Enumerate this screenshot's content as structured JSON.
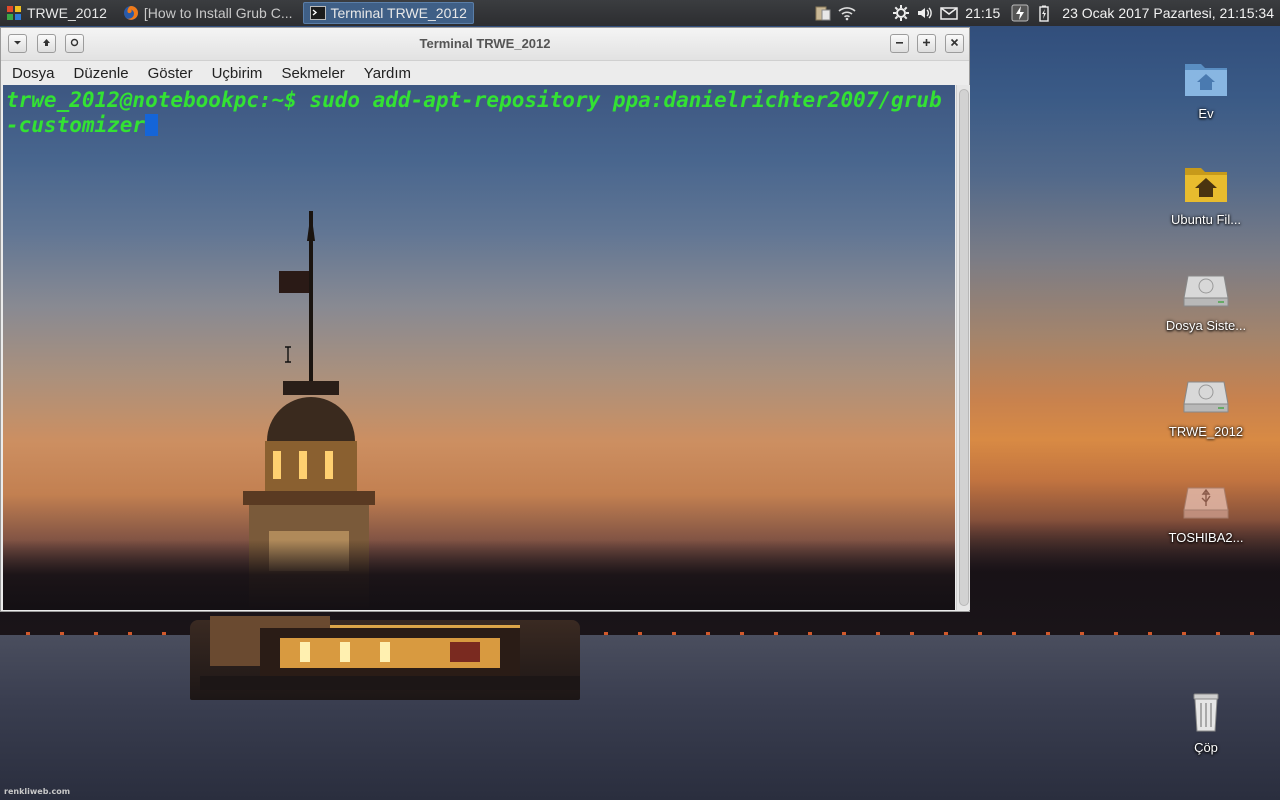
{
  "taskbar": {
    "items": [
      {
        "label": "TRWE_2012",
        "icon": "app-menu-icon"
      },
      {
        "label": "[How to Install Grub C...",
        "icon": "firefox-icon"
      },
      {
        "label": "Terminal TRWE_2012",
        "icon": "terminal-icon",
        "active": true
      }
    ],
    "tray": {
      "time_short": "21:15",
      "date": "23 Ocak 2017 Pazartesi, 21:15:34",
      "icons": [
        "clipboard-icon",
        "wifi-icon",
        "settings-icon",
        "volume-icon",
        "mail-icon",
        "power-icon",
        "battery-icon"
      ]
    }
  },
  "window": {
    "title": "Terminal TRWE_2012",
    "menu": [
      "Dosya",
      "Düzenle",
      "Göster",
      "Uçbirim",
      "Sekmeler",
      "Yardım"
    ],
    "terminal": {
      "line": "trwe_2012@notebookpc:~$ sudo add-apt-repository ppa:danielrichter2007/grub-customizer",
      "text_color": "#33e233",
      "cursor_color": "#1565d8"
    }
  },
  "desktop": {
    "icons": [
      {
        "label": "Ev",
        "icon": "home-folder-icon"
      },
      {
        "label": "Ubuntu Fil...",
        "icon": "folder-icon"
      },
      {
        "label": "Dosya Siste...",
        "icon": "drive-icon"
      },
      {
        "label": "TRWE_2012",
        "icon": "drive-icon"
      },
      {
        "label": "TOSHIBA2...",
        "icon": "usb-drive-icon"
      },
      {
        "label": "Çöp",
        "icon": "trash-icon"
      }
    ],
    "watermark": "renkliweb.com"
  }
}
